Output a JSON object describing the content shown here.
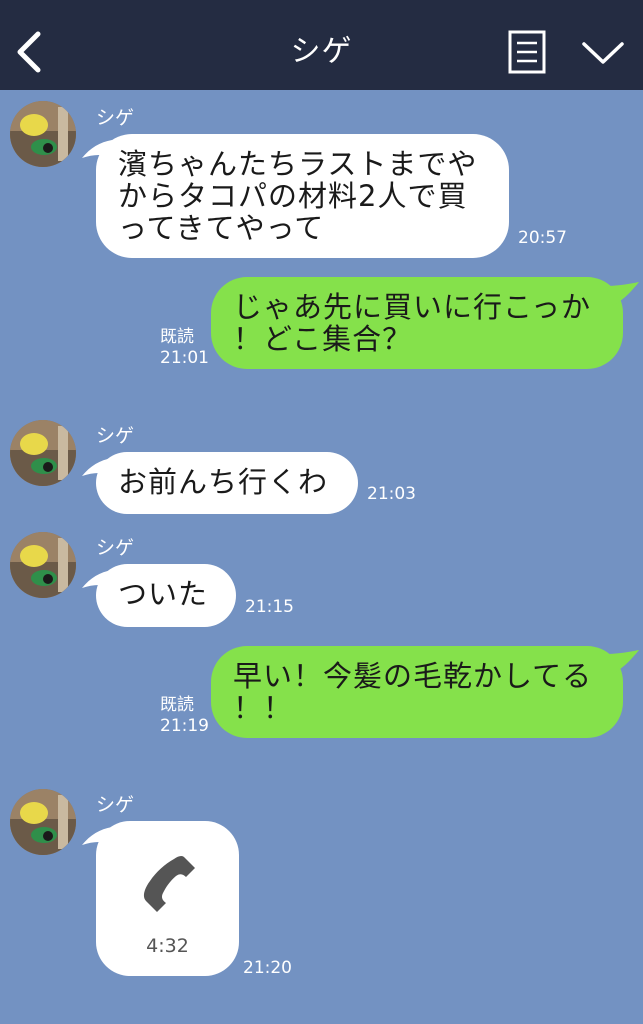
{
  "header": {
    "title": "シゲ"
  },
  "icons": {
    "back": "chevron-left-icon",
    "menu": "menu-icon",
    "collapse": "chevron-down-icon",
    "call": "phone-icon"
  },
  "colors": {
    "header_bg": "#242c42",
    "chat_bg": "#7392c2",
    "outgoing": "#85e14b",
    "incoming": "#ffffff"
  },
  "messages": [
    {
      "direction": "in",
      "sender": "シゲ",
      "lines": [
        "濱ちゃんたちラストまでや",
        "からタコパの材料2人で買",
        "ってきてやって"
      ],
      "time": "20:57"
    },
    {
      "direction": "out",
      "lines": [
        "じゃあ先に買いに行こっか",
        "！どこ集合？"
      ],
      "read": "既読",
      "time": "21:01"
    },
    {
      "direction": "in",
      "sender": "シゲ",
      "lines": [
        "お前んち行くわ"
      ],
      "time": "21:03"
    },
    {
      "direction": "in",
      "sender": "シゲ",
      "lines": [
        "ついた"
      ],
      "time": "21:15"
    },
    {
      "direction": "out",
      "lines": [
        "早い！今髪の毛乾かしてる",
        "！！"
      ],
      "read": "既読",
      "time": "21:19"
    },
    {
      "direction": "in",
      "sender": "シゲ",
      "call": true,
      "duration": "4:32",
      "time": "21:20"
    }
  ]
}
